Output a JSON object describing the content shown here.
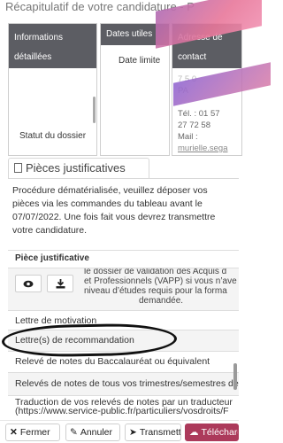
{
  "page": {
    "title": "Récapitulatif de votre candidature - P"
  },
  "cards": {
    "infos": {
      "title": "Informations détaillées",
      "status_label": "Statut du dossier"
    },
    "dates": {
      "title": "Dates utiles",
      "deadline_label": "Date limite"
    },
    "contact": {
      "title": "Adresse de contact",
      "faded1": "7 5 0",
      "faded2": "PA",
      "phone_label": "Tél. : 01 57",
      "phone_rest": "27 72 58",
      "mail_label": "Mail :",
      "mail_value": "murielle.sega"
    }
  },
  "tab": {
    "label": "Pièces justificatives"
  },
  "description": "Procédure dématérialisée, veuillez déposer vos pièces via les commandes du tableau avant le 07/07/2022. Une fois fait vous devrez transmettre votre candidature.",
  "table": {
    "header": "Pièce justificative",
    "overflow_lines": [
      "le dossier de validation des Acquis d",
      "et Professionnels (VAPP) si vous n’ave",
      "niveau d’études requis pour la forma",
      "demandée."
    ],
    "rows": [
      "Lettre de motivation",
      "Lettre(s) de recommandation",
      "Relevé de notes du Baccalauréat ou équivalent",
      "Relevés de notes de tous vos trimestres/semestres de"
    ],
    "last_row_line1": "Traduction de vos relevés de notes par un traducteur",
    "last_row_line2": "(https://www.service-public.fr/particuliers/vosdroits/F"
  },
  "footer": {
    "close": "Fermer",
    "cancel": "Annuler",
    "transmit": "Transmettre",
    "download": "Télécharger"
  },
  "colors": {
    "header_bg": "#5c5d63",
    "download_bg": "#ac3a5b",
    "ribbon": "#e8779a"
  }
}
